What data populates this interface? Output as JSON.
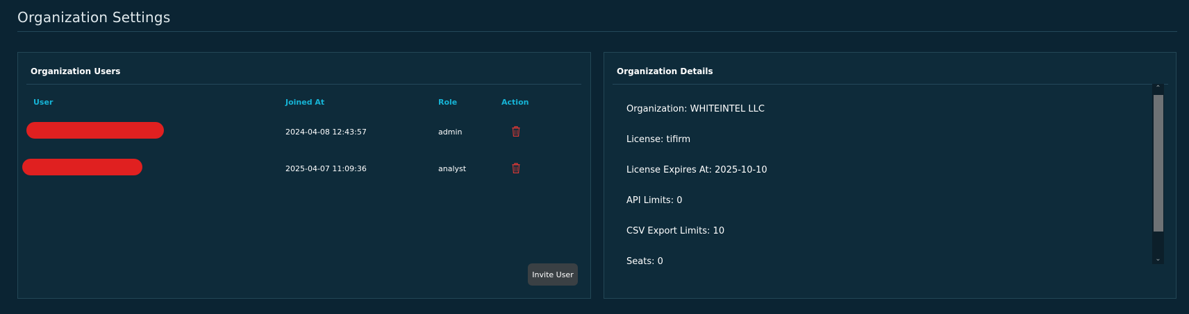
{
  "page": {
    "title": "Organization Settings"
  },
  "users_card": {
    "title": "Organization Users",
    "columns": {
      "user": "User",
      "joined_at": "Joined At",
      "role": "Role",
      "action": "Action"
    },
    "rows": [
      {
        "joined_at": "2024-04-08 12:43:57",
        "role": "admin"
      },
      {
        "joined_at": "2025-04-07 11:09:36",
        "role": "analyst"
      }
    ],
    "invite_label": "Invite User"
  },
  "details_card": {
    "title": "Organization Details",
    "lines": [
      "Organization: WHITEINTEL LLC",
      "License: tifirm",
      "License Expires At: 2025-10-10",
      "API Limits: 0",
      "CSV Export Limits: 10",
      "Seats: 0"
    ]
  },
  "colors": {
    "background": "#0b2433",
    "card": "#0e2b3a",
    "accent": "#16b4d6",
    "redaction": "#e02020",
    "delete_icon": "#e53935"
  },
  "icons": {
    "delete": "trash-icon",
    "scroll_up": "chevron-up-icon",
    "scroll_down": "chevron-down-icon"
  }
}
